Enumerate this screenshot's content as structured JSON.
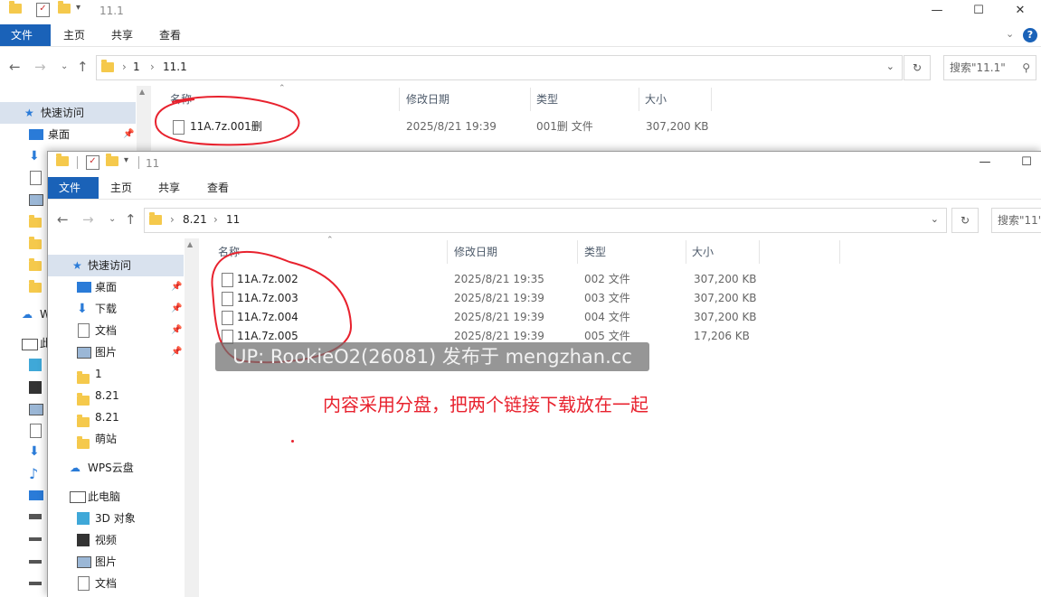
{
  "back_window": {
    "title": "11.1",
    "ribbon": [
      "文件",
      "主页",
      "共享",
      "查看"
    ],
    "breadcrumb": [
      "1",
      "11.1"
    ],
    "search_placeholder": "搜索\"11.1\"",
    "nav": {
      "quick_access": "快速访问",
      "desktop": "桌面"
    },
    "columns": [
      "名称",
      "修改日期",
      "类型",
      "大小"
    ],
    "files": [
      {
        "name": "11A.7z.001删",
        "date": "2025/8/21 19:39",
        "type": "001删 文件",
        "size": "307,200 KB"
      }
    ],
    "side_labels": [
      "W",
      "此"
    ]
  },
  "front_window": {
    "title": "11",
    "ribbon": [
      "文件",
      "主页",
      "共享",
      "查看"
    ],
    "breadcrumb": [
      "8.21",
      "11"
    ],
    "search_placeholder": "搜索\"11\"",
    "nav": [
      {
        "label": "快速访问",
        "icon": "star-icon"
      },
      {
        "label": "桌面",
        "icon": "desktop-icon",
        "pinned": true
      },
      {
        "label": "下载",
        "icon": "download-icon",
        "pinned": true
      },
      {
        "label": "文档",
        "icon": "document-icon",
        "pinned": true
      },
      {
        "label": "图片",
        "icon": "picture-icon",
        "pinned": true
      },
      {
        "label": "1",
        "icon": "folder-icon"
      },
      {
        "label": "8.21",
        "icon": "folder-icon"
      },
      {
        "label": "8.21",
        "icon": "folder-icon"
      },
      {
        "label": "萌站",
        "icon": "folder-icon"
      },
      {
        "label": "WPS云盘",
        "icon": "cloud-icon"
      },
      {
        "label": "此电脑",
        "icon": "pc-icon"
      },
      {
        "label": "3D 对象",
        "icon": "3d-icon"
      },
      {
        "label": "视频",
        "icon": "video-icon"
      },
      {
        "label": "图片",
        "icon": "picture-icon"
      },
      {
        "label": "文档",
        "icon": "document-icon"
      }
    ],
    "columns": [
      "名称",
      "修改日期",
      "类型",
      "大小"
    ],
    "files": [
      {
        "name": "11A.7z.002",
        "date": "2025/8/21 19:35",
        "type": "002 文件",
        "size": "307,200 KB"
      },
      {
        "name": "11A.7z.003",
        "date": "2025/8/21 19:39",
        "type": "003 文件",
        "size": "307,200 KB"
      },
      {
        "name": "11A.7z.004",
        "date": "2025/8/21 19:39",
        "type": "004 文件",
        "size": "307,200 KB"
      },
      {
        "name": "11A.7z.005",
        "date": "2025/8/21 19:39",
        "type": "005 文件",
        "size": "17,206 KB"
      }
    ]
  },
  "watermark": "UP: RookieO2(26081) 发布于 mengzhan.cc",
  "annotation": "内容采用分盘，把两个链接下载放在一起",
  "colors": {
    "accent": "#1a62b8",
    "annotation": "#e8222e",
    "selected": "#d9e2ee"
  }
}
